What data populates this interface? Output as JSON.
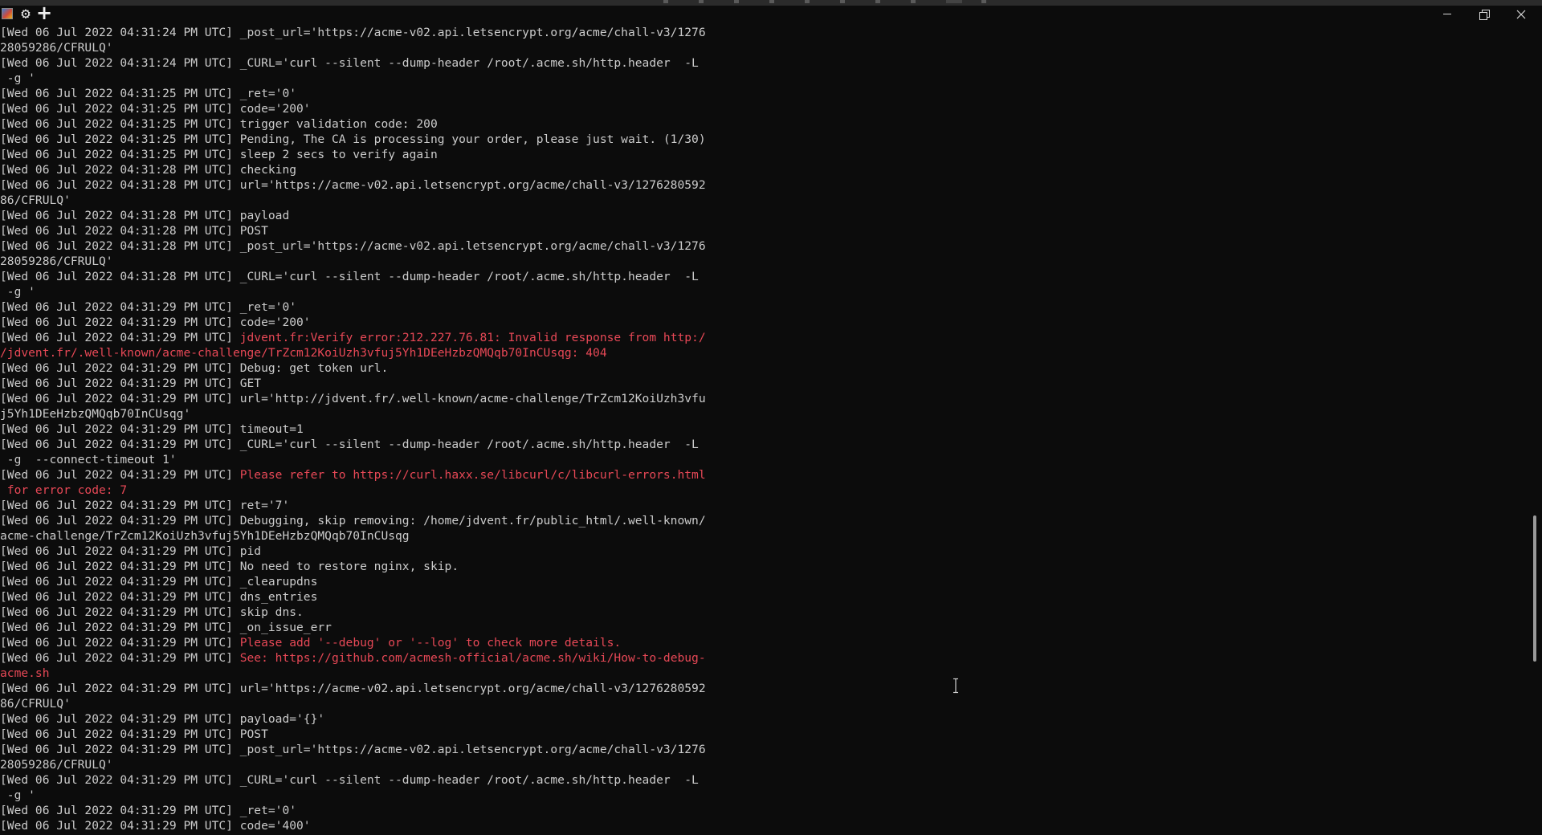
{
  "window": {
    "app_icon": "terminal-app-icon",
    "settings_icon": "gear-icon",
    "new_tab_icon": "plus-icon",
    "controls": [
      "minimize-icon",
      "maximize-icon",
      "close-icon"
    ]
  },
  "colors": {
    "background": "#0c0c0c",
    "foreground": "#cccccc",
    "error": "#e74856"
  },
  "terminal": {
    "lines": [
      {
        "text": "[Wed 06 Jul 2022 04:31:24 PM UTC] _post_url='https://acme-v02.api.letsencrypt.org/acme/chall-v3/1276",
        "type": "normal"
      },
      {
        "text": "28059286/CFRULQ'",
        "type": "normal"
      },
      {
        "text": "[Wed 06 Jul 2022 04:31:24 PM UTC] _CURL='curl --silent --dump-header /root/.acme.sh/http.header  -L",
        "type": "normal"
      },
      {
        "text": " -g '",
        "type": "normal"
      },
      {
        "text": "[Wed 06 Jul 2022 04:31:25 PM UTC] _ret='0'",
        "type": "normal"
      },
      {
        "text": "[Wed 06 Jul 2022 04:31:25 PM UTC] code='200'",
        "type": "normal"
      },
      {
        "text": "[Wed 06 Jul 2022 04:31:25 PM UTC] trigger validation code: 200",
        "type": "normal"
      },
      {
        "text": "[Wed 06 Jul 2022 04:31:25 PM UTC] Pending, The CA is processing your order, please just wait. (1/30)",
        "type": "normal"
      },
      {
        "text": "[Wed 06 Jul 2022 04:31:25 PM UTC] sleep 2 secs to verify again",
        "type": "normal"
      },
      {
        "text": "[Wed 06 Jul 2022 04:31:28 PM UTC] checking",
        "type": "normal"
      },
      {
        "text": "[Wed 06 Jul 2022 04:31:28 PM UTC] url='https://acme-v02.api.letsencrypt.org/acme/chall-v3/1276280592",
        "type": "normal"
      },
      {
        "text": "86/CFRULQ'",
        "type": "normal"
      },
      {
        "text": "[Wed 06 Jul 2022 04:31:28 PM UTC] payload",
        "type": "normal"
      },
      {
        "text": "[Wed 06 Jul 2022 04:31:28 PM UTC] POST",
        "type": "normal"
      },
      {
        "text": "[Wed 06 Jul 2022 04:31:28 PM UTC] _post_url='https://acme-v02.api.letsencrypt.org/acme/chall-v3/1276",
        "type": "normal"
      },
      {
        "text": "28059286/CFRULQ'",
        "type": "normal"
      },
      {
        "text": "[Wed 06 Jul 2022 04:31:28 PM UTC] _CURL='curl --silent --dump-header /root/.acme.sh/http.header  -L",
        "type": "normal"
      },
      {
        "text": " -g '",
        "type": "normal"
      },
      {
        "text": "[Wed 06 Jul 2022 04:31:29 PM UTC] _ret='0'",
        "type": "normal"
      },
      {
        "text": "[Wed 06 Jul 2022 04:31:29 PM UTC] code='200'",
        "type": "normal"
      },
      {
        "prefix": "[Wed 06 Jul 2022 04:31:29 PM UTC] ",
        "text": "jdvent.fr:Verify error:212.227.76.81: Invalid response from http:/",
        "type": "error"
      },
      {
        "text": "/jdvent.fr/.well-known/acme-challenge/TrZcm12KoiUzh3vfuj5Yh1DEeHzbzQMQqb70InCUsqg: 404",
        "type": "error"
      },
      {
        "text": "[Wed 06 Jul 2022 04:31:29 PM UTC] Debug: get token url.",
        "type": "normal"
      },
      {
        "text": "[Wed 06 Jul 2022 04:31:29 PM UTC] GET",
        "type": "normal"
      },
      {
        "text": "[Wed 06 Jul 2022 04:31:29 PM UTC] url='http://jdvent.fr/.well-known/acme-challenge/TrZcm12KoiUzh3vfu",
        "type": "normal"
      },
      {
        "text": "j5Yh1DEeHzbzQMQqb70InCUsqg'",
        "type": "normal"
      },
      {
        "text": "[Wed 06 Jul 2022 04:31:29 PM UTC] timeout=1",
        "type": "normal"
      },
      {
        "text": "[Wed 06 Jul 2022 04:31:29 PM UTC] _CURL='curl --silent --dump-header /root/.acme.sh/http.header  -L",
        "type": "normal"
      },
      {
        "text": " -g  --connect-timeout 1'",
        "type": "normal"
      },
      {
        "prefix": "[Wed 06 Jul 2022 04:31:29 PM UTC] ",
        "text": "Please refer to https://curl.haxx.se/libcurl/c/libcurl-errors.html",
        "type": "error"
      },
      {
        "text": " for error code: 7",
        "type": "error"
      },
      {
        "text": "[Wed 06 Jul 2022 04:31:29 PM UTC] ret='7'",
        "type": "normal"
      },
      {
        "text": "[Wed 06 Jul 2022 04:31:29 PM UTC] Debugging, skip removing: /home/jdvent.fr/public_html/.well-known/",
        "type": "normal"
      },
      {
        "text": "acme-challenge/TrZcm12KoiUzh3vfuj5Yh1DEeHzbzQMQqb70InCUsqg",
        "type": "normal"
      },
      {
        "text": "[Wed 06 Jul 2022 04:31:29 PM UTC] pid",
        "type": "normal"
      },
      {
        "text": "[Wed 06 Jul 2022 04:31:29 PM UTC] No need to restore nginx, skip.",
        "type": "normal"
      },
      {
        "text": "[Wed 06 Jul 2022 04:31:29 PM UTC] _clearupdns",
        "type": "normal"
      },
      {
        "text": "[Wed 06 Jul 2022 04:31:29 PM UTC] dns_entries",
        "type": "normal"
      },
      {
        "text": "[Wed 06 Jul 2022 04:31:29 PM UTC] skip dns.",
        "type": "normal"
      },
      {
        "text": "[Wed 06 Jul 2022 04:31:29 PM UTC] _on_issue_err",
        "type": "normal"
      },
      {
        "prefix": "[Wed 06 Jul 2022 04:31:29 PM UTC] ",
        "text": "Please add '--debug' or '--log' to check more details.",
        "type": "error"
      },
      {
        "prefix": "[Wed 06 Jul 2022 04:31:29 PM UTC] ",
        "text": "See: https://github.com/acmesh-official/acme.sh/wiki/How-to-debug-",
        "type": "error"
      },
      {
        "text": "acme.sh",
        "type": "error"
      },
      {
        "text": "[Wed 06 Jul 2022 04:31:29 PM UTC] url='https://acme-v02.api.letsencrypt.org/acme/chall-v3/1276280592",
        "type": "normal"
      },
      {
        "text": "86/CFRULQ'",
        "type": "normal"
      },
      {
        "text": "[Wed 06 Jul 2022 04:31:29 PM UTC] payload='{}'",
        "type": "normal"
      },
      {
        "text": "[Wed 06 Jul 2022 04:31:29 PM UTC] POST",
        "type": "normal"
      },
      {
        "text": "[Wed 06 Jul 2022 04:31:29 PM UTC] _post_url='https://acme-v02.api.letsencrypt.org/acme/chall-v3/1276",
        "type": "normal"
      },
      {
        "text": "28059286/CFRULQ'",
        "type": "normal"
      },
      {
        "text": "[Wed 06 Jul 2022 04:31:29 PM UTC] _CURL='curl --silent --dump-header /root/.acme.sh/http.header  -L",
        "type": "normal"
      },
      {
        "text": " -g '",
        "type": "normal"
      },
      {
        "text": "[Wed 06 Jul 2022 04:31:29 PM UTC] _ret='0'",
        "type": "normal"
      },
      {
        "text": "[Wed 06 Jul 2022 04:31:29 PM UTC] code='400'",
        "type": "normal"
      }
    ]
  }
}
